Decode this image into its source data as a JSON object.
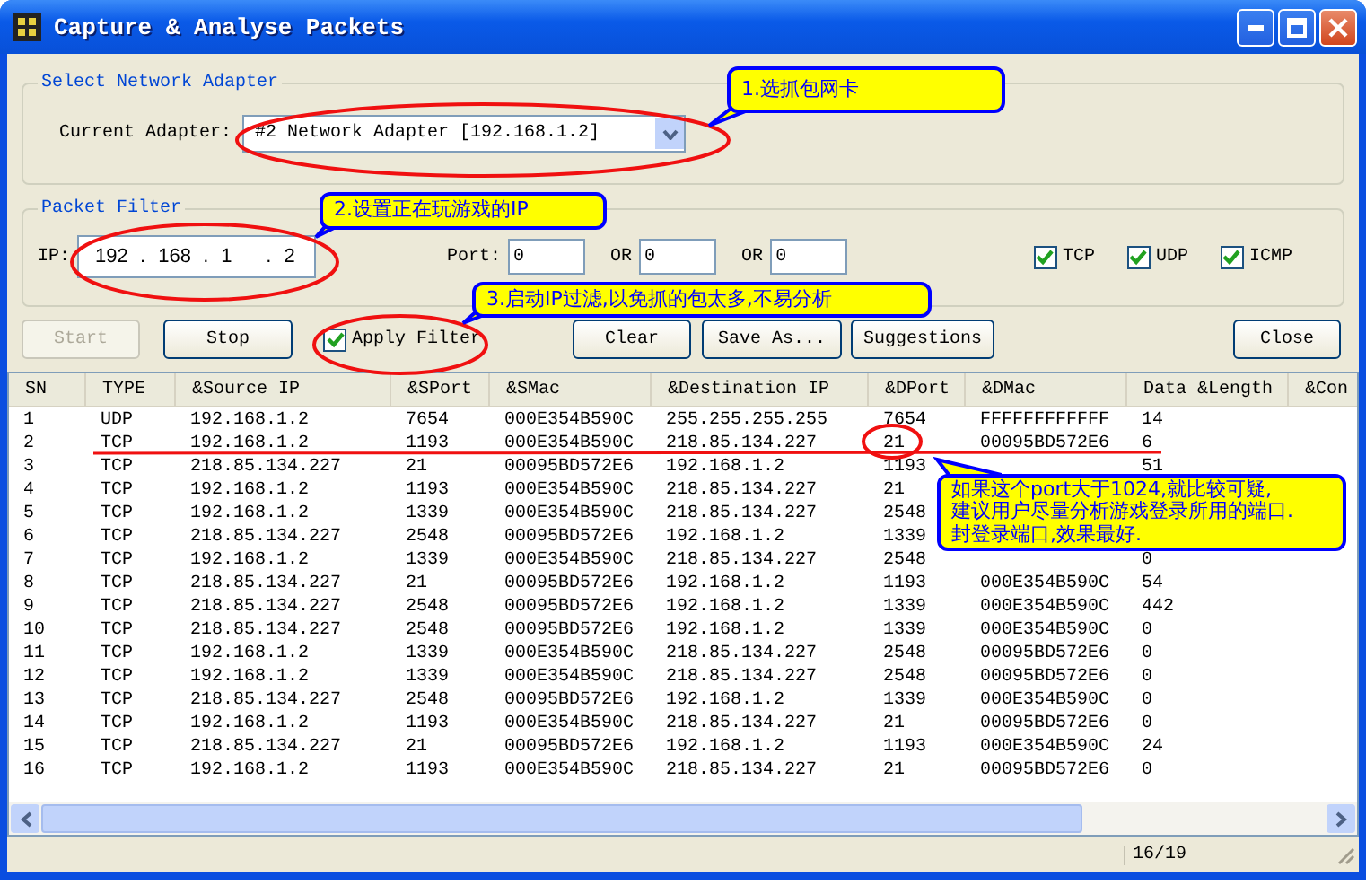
{
  "window": {
    "title": "Capture & Analyse Packets"
  },
  "adapter_group": {
    "title": "Select Network Adapter",
    "label": "Current Adapter:",
    "value": "#2 Network Adapter [192.168.1.2]"
  },
  "filter_group": {
    "title": "Packet Filter",
    "ip_label": "IP:",
    "ip_octets": [
      "192",
      "168",
      "1",
      "2"
    ],
    "ip_separator": ".",
    "port_label": "Port:",
    "port_value": "0",
    "or_fields": [
      {
        "label": "OR",
        "value": "0"
      },
      {
        "label": "OR",
        "value": "0"
      }
    ],
    "protocols": [
      {
        "label": "TCP",
        "checked": true
      },
      {
        "label": "UDP",
        "checked": true
      },
      {
        "label": "ICMP",
        "checked": true
      }
    ]
  },
  "controls": [
    {
      "kind": "button",
      "label": "Start",
      "disabled": true
    },
    {
      "kind": "button",
      "label": "Stop",
      "disabled": false
    },
    {
      "kind": "checkbox",
      "label": "Apply Filter",
      "checked": true
    },
    {
      "kind": "button",
      "label": "Clear",
      "disabled": false
    },
    {
      "kind": "button",
      "label": "Save As...",
      "disabled": false
    },
    {
      "kind": "button",
      "label": "Suggestions",
      "disabled": false
    },
    {
      "kind": "button",
      "label": "Close",
      "disabled": false
    }
  ],
  "table": {
    "columns": [
      "SN",
      "TYPE",
      "&Source IP",
      "&SPort",
      "&SMac",
      "&Destination IP",
      "&DPort",
      "&DMac",
      "Data &Length",
      "&Con"
    ],
    "rows": [
      [
        "1",
        "UDP",
        "192.168.1.2",
        "7654",
        "000E354B590C",
        "255.255.255.255",
        "7654",
        "FFFFFFFFFFFF",
        "14"
      ],
      [
        "2",
        "TCP",
        "192.168.1.2",
        "1193",
        "000E354B590C",
        "218.85.134.227",
        "21",
        "00095BD572E6",
        "6"
      ],
      [
        "3",
        "TCP",
        "218.85.134.227",
        "21",
        "00095BD572E6",
        "192.168.1.2",
        "1193",
        null,
        "51"
      ],
      [
        "4",
        "TCP",
        "192.168.1.2",
        "1193",
        "000E354B590C",
        "218.85.134.227",
        "21",
        null,
        null
      ],
      [
        "5",
        "TCP",
        "192.168.1.2",
        "1339",
        "000E354B590C",
        "218.85.134.227",
        "2548",
        null,
        null
      ],
      [
        "6",
        "TCP",
        "218.85.134.227",
        "2548",
        "00095BD572E6",
        "192.168.1.2",
        "1339",
        null,
        null
      ],
      [
        "7",
        "TCP",
        "192.168.1.2",
        "1339",
        "000E354B590C",
        "218.85.134.227",
        "2548",
        null,
        "0"
      ],
      [
        "8",
        "TCP",
        "218.85.134.227",
        "21",
        "00095BD572E6",
        "192.168.1.2",
        "1193",
        "000E354B590C",
        "54"
      ],
      [
        "9",
        "TCP",
        "218.85.134.227",
        "2548",
        "00095BD572E6",
        "192.168.1.2",
        "1339",
        "000E354B590C",
        "442"
      ],
      [
        "10",
        "TCP",
        "218.85.134.227",
        "2548",
        "00095BD572E6",
        "192.168.1.2",
        "1339",
        "000E354B590C",
        "0"
      ],
      [
        "11",
        "TCP",
        "192.168.1.2",
        "1339",
        "000E354B590C",
        "218.85.134.227",
        "2548",
        "00095BD572E6",
        "0"
      ],
      [
        "12",
        "TCP",
        "192.168.1.2",
        "1339",
        "000E354B590C",
        "218.85.134.227",
        "2548",
        "00095BD572E6",
        "0"
      ],
      [
        "13",
        "TCP",
        "218.85.134.227",
        "2548",
        "00095BD572E6",
        "192.168.1.2",
        "1339",
        "000E354B590C",
        "0"
      ],
      [
        "14",
        "TCP",
        "192.168.1.2",
        "1193",
        "000E354B590C",
        "218.85.134.227",
        "21",
        "00095BD572E6",
        "0"
      ],
      [
        "15",
        "TCP",
        "218.85.134.227",
        "21",
        "00095BD572E6",
        "192.168.1.2",
        "1193",
        "000E354B590C",
        "24"
      ],
      [
        "16",
        "TCP",
        "192.168.1.2",
        "1193",
        "000E354B590C",
        "218.85.134.227",
        "21",
        "00095BD572E6",
        "0"
      ]
    ]
  },
  "status_bar": {
    "count": "16/19"
  },
  "callouts": [
    {
      "text": "1.选抓包网卡"
    },
    {
      "text": "2.设置正在玩游戏的IP"
    },
    {
      "text": "3.启动IP过滤,以免抓的包太多,不易分析"
    },
    {
      "text": "如果这个port大于1024,就比较可疑,\n建议用户尽量分析游戏登录所用的端口.\n封登录端口,效果最好."
    }
  ]
}
